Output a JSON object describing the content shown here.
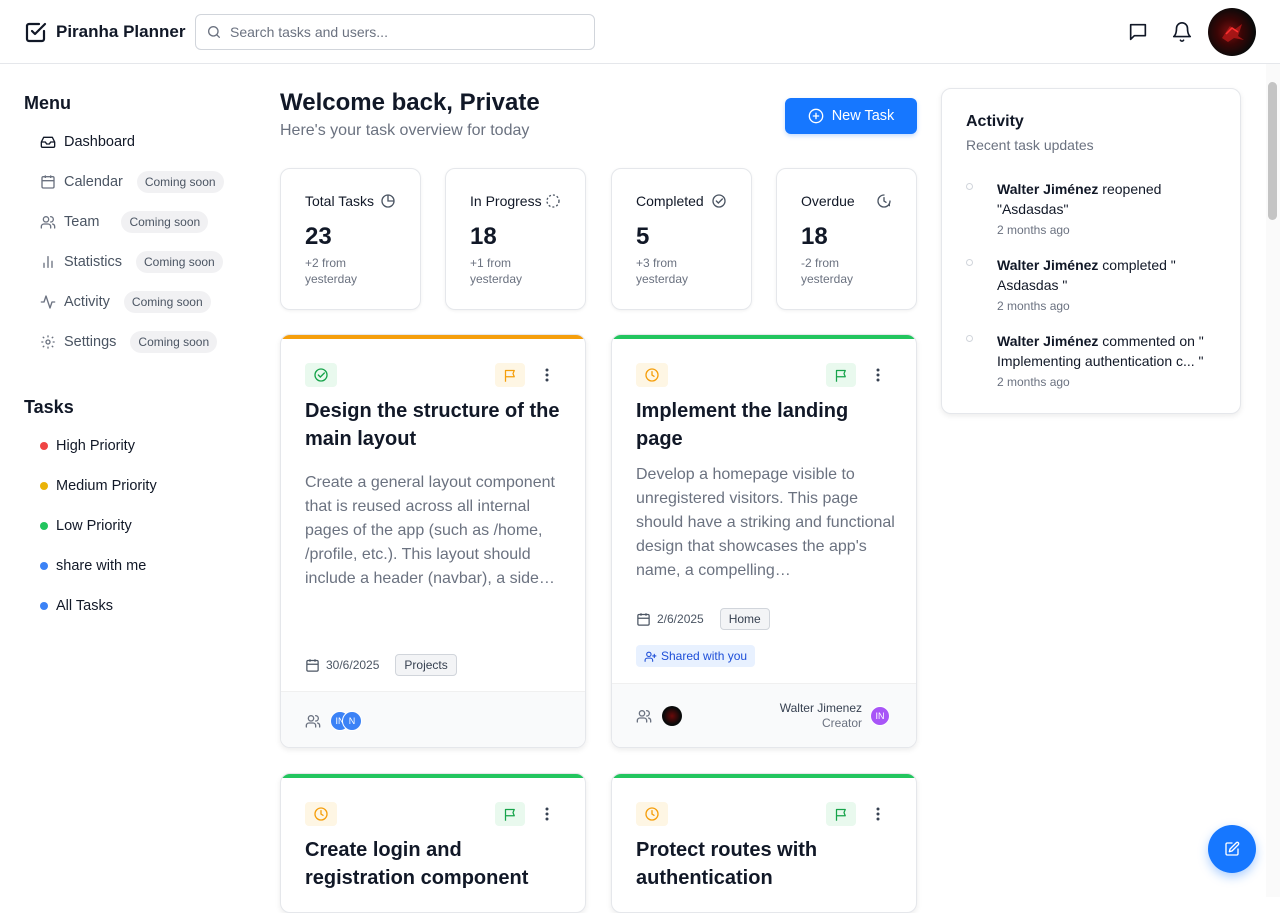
{
  "app": {
    "name": "Piranha Planner"
  },
  "header": {
    "search_placeholder": "Search tasks and users...",
    "icons": [
      "checkbox-logo-icon",
      "search-icon",
      "message-icon",
      "bell-icon"
    ]
  },
  "sidebar": {
    "menu_title": "Menu",
    "menu": [
      {
        "label": "Dashboard",
        "icon": "inbox-icon",
        "badge": ""
      },
      {
        "label": "Calendar",
        "icon": "calendar-icon",
        "badge": "Coming soon"
      },
      {
        "label": "Team",
        "icon": "users-icon",
        "badge": "Coming soon"
      },
      {
        "label": "Statistics",
        "icon": "bar-chart-icon",
        "badge": "Coming soon"
      },
      {
        "label": "Activity",
        "icon": "activity-icon",
        "badge": "Coming soon"
      },
      {
        "label": "Settings",
        "icon": "gear-icon",
        "badge": "Coming soon"
      }
    ],
    "tasks_title": "Tasks",
    "tasks": [
      {
        "label": "High Priority",
        "color": "#ef4444"
      },
      {
        "label": "Medium Priority",
        "color": "#eab308"
      },
      {
        "label": "Low Priority",
        "color": "#22c55e"
      },
      {
        "label": "share with me",
        "color": "#3b82f6"
      },
      {
        "label": "All Tasks",
        "color": "#3b82f6"
      }
    ]
  },
  "main": {
    "welcome": "Welcome back, Private",
    "subtitle": "Here's your task overview for today",
    "new_task_label": "New Task",
    "stats": [
      {
        "label": "Total Tasks",
        "value": "23",
        "note": "+2 from yesterday",
        "icon": "pie-clock-icon"
      },
      {
        "label": "In Progress",
        "value": "18",
        "note": "+1 from yesterday",
        "icon": "dashed-circle-icon"
      },
      {
        "label": "Completed",
        "value": "5",
        "note": "+3 from yesterday",
        "icon": "check-circle-icon"
      },
      {
        "label": "Overdue",
        "value": "18",
        "note": "-2 from yesterday",
        "icon": "clock-alert-icon"
      }
    ],
    "cards": [
      {
        "title": "Design the structure of the main layout",
        "description": "Create a general layout component that is reused across all internal pages of the app (such as /home, /profile, etc.). This layout should include a header (navbar), a side…",
        "date": "30/6/2025",
        "tag": "Projects",
        "bar_color": "#f59e0b",
        "status_icon": "check-circle-icon",
        "status_color": "#16a34a",
        "flag_color": "#f59e0b",
        "shared_label": "",
        "avatars": [
          "IN",
          "N"
        ],
        "creator_name": "",
        "creator_role": ""
      },
      {
        "title": "Implement the landing page",
        "description": "Develop a homepage visible to unregistered visitors. This page should have a striking and functional design that showcases the app's name, a compelling…",
        "date": "2/6/2025",
        "tag": "Home",
        "bar_color": "#22c55e",
        "status_icon": "clock-icon",
        "status_color": "#f59e0b",
        "flag_color": "#22c55e",
        "shared_label": "Shared with you",
        "avatars": [],
        "creator_name": "Walter Jimenez",
        "creator_role": "Creator",
        "creator_initials": "IN"
      },
      {
        "title": "Create login and registration component",
        "bar_color": "#22c55e",
        "status_icon": "clock-icon",
        "flag_color": "#22c55e"
      },
      {
        "title": "Protect routes with authentication",
        "bar_color": "#22c55e",
        "status_icon": "clock-icon",
        "flag_color": "#22c55e"
      }
    ]
  },
  "activity": {
    "title": "Activity",
    "subtitle": "Recent task updates",
    "entries": [
      {
        "user": "Walter Jiménez",
        "text": " reopened \"Asdasdas\"",
        "time": "2 months ago"
      },
      {
        "user": "Walter Jiménez",
        "text": " completed \" Asdasdas \"",
        "time": "2 months ago"
      },
      {
        "user": "Walter Jiménez",
        "text": " commented on \" Implementing authentication c... \"",
        "time": "2 months ago"
      }
    ]
  }
}
